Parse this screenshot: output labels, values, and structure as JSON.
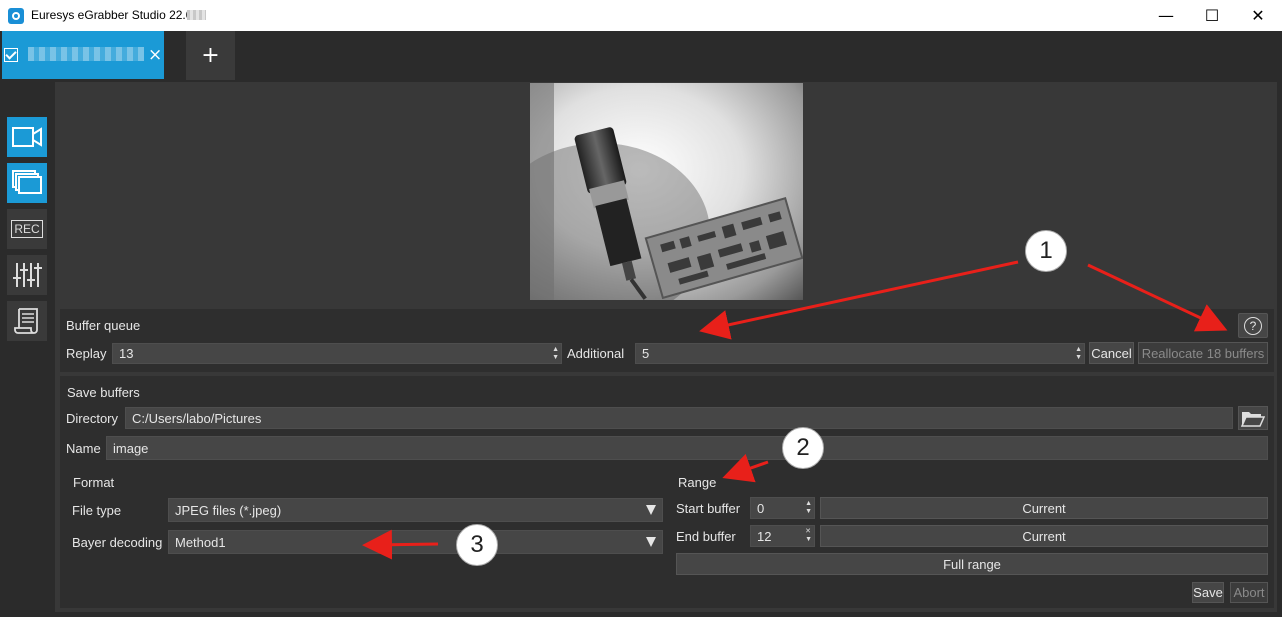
{
  "window": {
    "title": "Euresys eGrabber Studio 22.05",
    "minimize": "—",
    "maximize": "☐",
    "close": "✕"
  },
  "tabs": {
    "add_label": "+",
    "close_label": "×"
  },
  "sidebar": {
    "items": [
      {
        "name": "camera",
        "icon": "video-camera-icon",
        "active": true
      },
      {
        "name": "buffers",
        "icon": "stacked-frames-icon",
        "active": true
      },
      {
        "name": "recorder",
        "icon": "rec-icon",
        "label": "REC",
        "active": false
      },
      {
        "name": "controls",
        "icon": "sliders-icon",
        "active": false
      },
      {
        "name": "script",
        "icon": "scroll-icon",
        "active": false
      }
    ]
  },
  "buffer_queue": {
    "title": "Buffer queue",
    "replay_label": "Replay",
    "replay_value": "13",
    "additional_label": "Additional",
    "additional_value": "5",
    "cancel_label": "Cancel",
    "reallocate_label": "Reallocate 18 buffers",
    "help_label": "?"
  },
  "save_buffers": {
    "title": "Save buffers",
    "directory_label": "Directory",
    "directory_value": "C:/Users/labo/Pictures",
    "name_label": "Name",
    "name_value": "image",
    "format": {
      "title": "Format",
      "file_type_label": "File type",
      "file_type_value": "JPEG files (*.jpeg)",
      "bayer_label": "Bayer decoding",
      "bayer_value": "Method1"
    },
    "range": {
      "title": "Range",
      "start_label": "Start buffer",
      "start_value": "0",
      "end_label": "End buffer",
      "end_value": "12",
      "current_label": "Current",
      "full_range_label": "Full range"
    },
    "save_label": "Save",
    "abort_label": "Abort"
  },
  "annotations": {
    "badge_1": "1",
    "badge_2": "2",
    "badge_3": "3",
    "arrow_color": "#e8201a"
  },
  "colors": {
    "accent": "#1b9ad6",
    "panel": "#383838",
    "section": "#2e2e2e",
    "field": "#464646"
  }
}
